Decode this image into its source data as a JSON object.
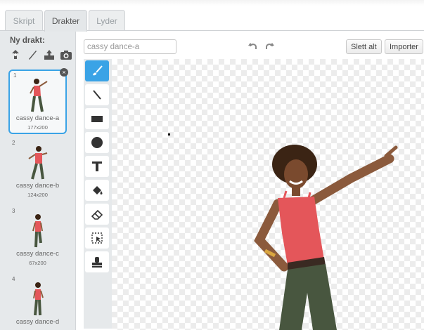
{
  "tabs": [
    {
      "label": "Skript",
      "active": false
    },
    {
      "label": "Drakter",
      "active": true
    },
    {
      "label": "Lyder",
      "active": false
    }
  ],
  "new_costume": {
    "label": "Ny drakt:",
    "icons": [
      "choose-from-library-icon",
      "paint-new-icon",
      "upload-icon",
      "camera-icon"
    ]
  },
  "costumes": [
    {
      "number": "1",
      "name": "cassy dance-a",
      "size": "177x200",
      "selected": true
    },
    {
      "number": "2",
      "name": "cassy dance-b",
      "size": "124x200",
      "selected": false
    },
    {
      "number": "3",
      "name": "cassy dance-c",
      "size": "67x200",
      "selected": false
    },
    {
      "number": "4",
      "name": "cassy dance-d",
      "size": "",
      "selected": false
    }
  ],
  "editor": {
    "costume_name_value": "cassy dance-a",
    "clear_label": "Slett alt",
    "import_label": "Importer"
  },
  "tools": [
    "brush-icon",
    "line-icon",
    "rectangle-icon",
    "ellipse-icon",
    "text-icon",
    "fill-icon",
    "eraser-icon",
    "select-icon",
    "stamp-icon"
  ],
  "colors": {
    "accent": "#3aa3e6",
    "panel": "#e6e9eb"
  }
}
